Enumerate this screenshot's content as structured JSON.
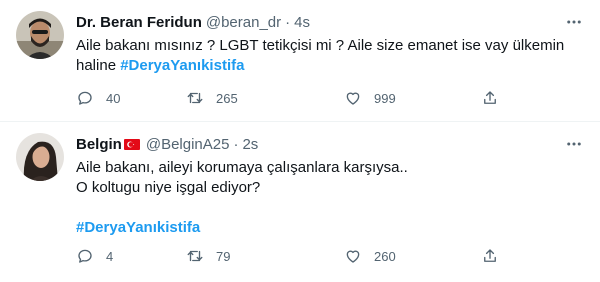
{
  "tweets": [
    {
      "author_name": "Dr. Beran Feridun",
      "handle": "@beran_dr",
      "separator": "·",
      "time": "4s",
      "text_line1": "Aile bakanı mısınız ? LGBT tetikçisi mi ? Aile size emanet ise vay ülkemin",
      "text_line2_prefix": "haline ",
      "hashtag": "#DeryaYanıkistifa",
      "replies": "40",
      "retweets": "265",
      "likes": "999"
    },
    {
      "author_name": "Belgin",
      "handle": "@BelginA25",
      "separator": "·",
      "time": "2s",
      "text_line1": "Aile bakanı, aileyi korumaya çalışanlara karşıysa..",
      "text_line2": "O koltugu niye işgal ediyor?",
      "hashtag": "#DeryaYanıkistifa",
      "replies": "4",
      "retweets": "79",
      "likes": "260"
    }
  ],
  "colors": {
    "text": "#0f1419",
    "secondary": "#536471",
    "hashtag": "#1d9bf0",
    "divider": "#eff3f4",
    "flag": "#e30a17"
  },
  "icons": [
    "reply-icon",
    "retweet-icon",
    "like-icon",
    "share-icon",
    "more-icon",
    "turkey-flag-icon"
  ]
}
